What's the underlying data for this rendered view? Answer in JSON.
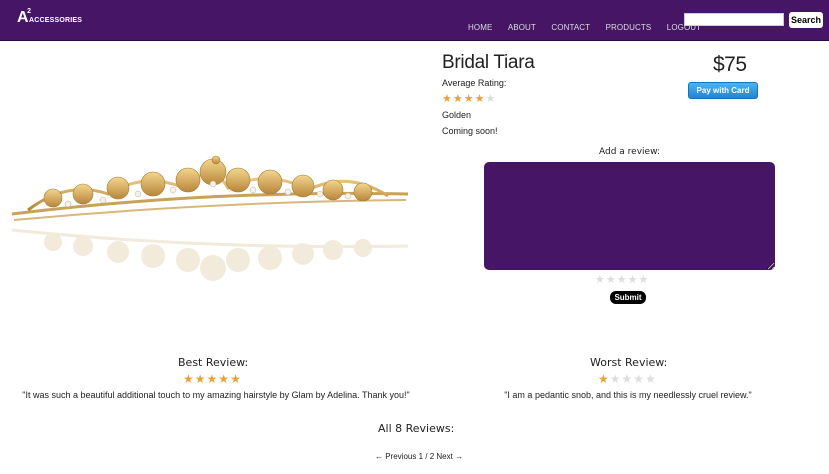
{
  "header": {
    "logo_big": "A",
    "logo_sup": "2",
    "logo_small": "ACCESSORIES",
    "nav": [
      "HOME",
      "ABOUT",
      "CONTACT",
      "PRODUCTS",
      "LOGOUT"
    ],
    "search_value": "",
    "search_button": "Search"
  },
  "product": {
    "name": "Bridal Tiara",
    "price": "$75",
    "pay_button": "Pay with Card",
    "avg_label": "Average Rating:",
    "avg_rating": 4,
    "color": "Golden",
    "status": "Coming soon!"
  },
  "review_form": {
    "label": "Add a review:",
    "value": "",
    "rating": 0,
    "submit": "Submit"
  },
  "best_review": {
    "title": "Best Review:",
    "rating": 5,
    "text": "\"It was such a beautiful additional touch to my amazing hairstyle by Glam by Adelina. Thank you!\""
  },
  "worst_review": {
    "title": "Worst Review:",
    "rating": 1,
    "text": "\"I am a pedantic snob, and this is my needlessly cruel review.\""
  },
  "all_reviews": {
    "title": "All 8 Reviews:",
    "prev": "← Previous",
    "page": "1 / 2",
    "next": "Next →"
  },
  "colors": {
    "brand_purple": "#461566",
    "star_on": "#e8a13a",
    "star_off": "#dddddd",
    "pay_blue": "#1f86d3"
  }
}
